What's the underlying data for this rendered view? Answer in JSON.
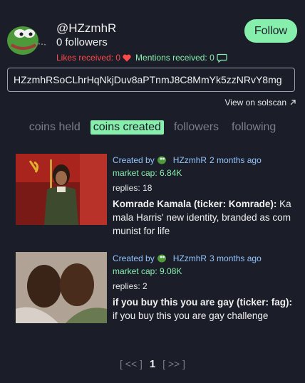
{
  "profile": {
    "handle": "@HZzmhR",
    "followers": "0 followers",
    "likes": "Likes received: 0",
    "mentions": "Mentions received: 0",
    "follow_label": "Follow",
    "address": "HZzmhRSoCLhrHqNkjDuv8aPTnmJ8C8MmYk5zzNRvY8mg",
    "solscan_label": "View on solscan"
  },
  "tabs": [
    {
      "label": "coins held",
      "active": false
    },
    {
      "label": "coins created",
      "active": true
    },
    {
      "label": "followers",
      "active": false
    },
    {
      "label": "following",
      "active": false
    }
  ],
  "coins": [
    {
      "created_by": "Created by",
      "creator": "HZzmhR",
      "age": "2 months ago",
      "market_cap": "market cap: 6.84K",
      "replies": "replies: 18",
      "name": "Komrade Kamala (ticker: Komrade):",
      "description": "Kamala Harris' new identity, branded as communist for life"
    },
    {
      "created_by": "Created by",
      "creator": "HZzmhR",
      "age": "3 months ago",
      "market_cap": "market cap: 9.08K",
      "replies": "replies: 2",
      "name": "if you buy this you are gay (ticker: fag):",
      "description": "if you buy this you are gay challenge"
    }
  ],
  "pager": {
    "prev": "[ << ]",
    "current": "1",
    "next": "[ >> ]"
  },
  "colors": {
    "background": "#1b1d28",
    "accent": "#86efac",
    "likes": "#ff4a4a",
    "link": "#93c5fd"
  }
}
